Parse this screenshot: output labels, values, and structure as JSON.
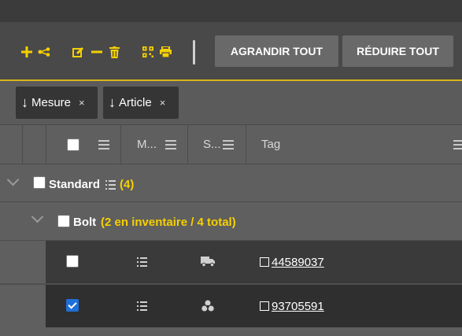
{
  "toolbar": {
    "icons": [
      "plus-icon",
      "tree-icon",
      "edit-icon",
      "minus-icon",
      "trash-icon",
      "qr-icon",
      "print-icon"
    ],
    "expand_all_label": "AGRANDIR TOUT",
    "collapse_all_label": "RÉDUIRE TOUT",
    "accent_color": "#f5d000"
  },
  "group_chips": [
    {
      "label": "Mesure",
      "arrow": "↓",
      "close": "×"
    },
    {
      "label": "Article",
      "arrow": "↓",
      "close": "×"
    }
  ],
  "columns": [
    {
      "label": "M..."
    },
    {
      "label": "S..."
    },
    {
      "label": "Tag"
    }
  ],
  "groups": [
    {
      "label": "Standard",
      "count": "(4)"
    },
    {
      "label": "Bolt",
      "count": "(2 en inventaire / 4 total)"
    }
  ],
  "rows": [
    {
      "checked": false,
      "status_icon": "truck-icon",
      "tag": "44589037"
    },
    {
      "checked": true,
      "status_icon": "biohazard-icon",
      "tag": "93705591"
    }
  ]
}
